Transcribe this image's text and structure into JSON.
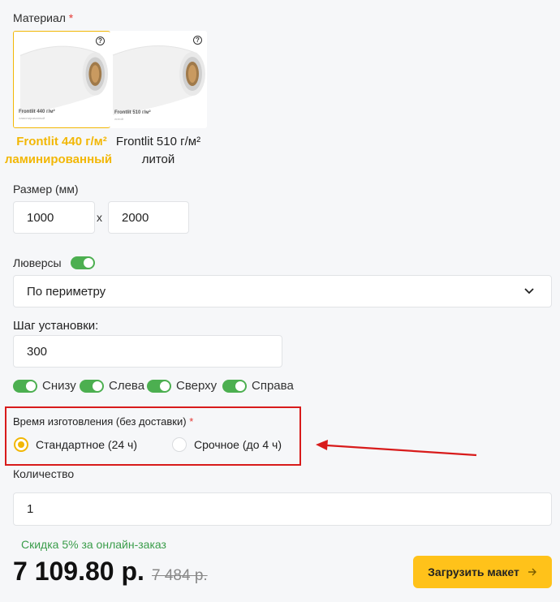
{
  "material": {
    "label": "Материал",
    "required_mark": "*",
    "options": [
      {
        "card_line1": "Frontlit 440 г/м²",
        "card_line2": "ламинированный",
        "name_line1": "Frontlit 440 г/м²",
        "name_line2": "ламинированный",
        "selected": true
      },
      {
        "card_line1": "Frontlit 510 г/м²",
        "card_line2": "литой",
        "name_line1": "Frontlit 510 г/м²",
        "name_line2": "литой",
        "selected": false
      }
    ],
    "help_glyph": "?"
  },
  "size": {
    "label": "Размер (мм)",
    "width": "1000",
    "separator": "x",
    "height": "2000"
  },
  "grommets": {
    "label": "Люверсы",
    "enabled": true,
    "placement": "По периметру",
    "step_label": "Шаг установки:",
    "step_value": "300",
    "sides": [
      "Снизу",
      "Слева",
      "Сверху",
      "Справа"
    ]
  },
  "production": {
    "label": "Время изготовления (без доставки)",
    "required_mark": "*",
    "options": [
      {
        "label": "Стандартное (24 ч)",
        "selected": true
      },
      {
        "label": "Срочное (до 4 ч)",
        "selected": false
      }
    ]
  },
  "quantity": {
    "label": "Количество",
    "value": "1"
  },
  "discount": "Скидка 5% за онлайн-заказ",
  "price": {
    "current": "7 109.80 р.",
    "old": "7 484 р."
  },
  "upload_button": {
    "label": "Загрузить макет",
    "icon": "arrow-right-icon"
  },
  "colors": {
    "accent": "#f2b705",
    "button": "#ffc21a",
    "toggle": "#4caf50",
    "discount": "#3a9d4a",
    "annotation": "#d81b1b"
  }
}
